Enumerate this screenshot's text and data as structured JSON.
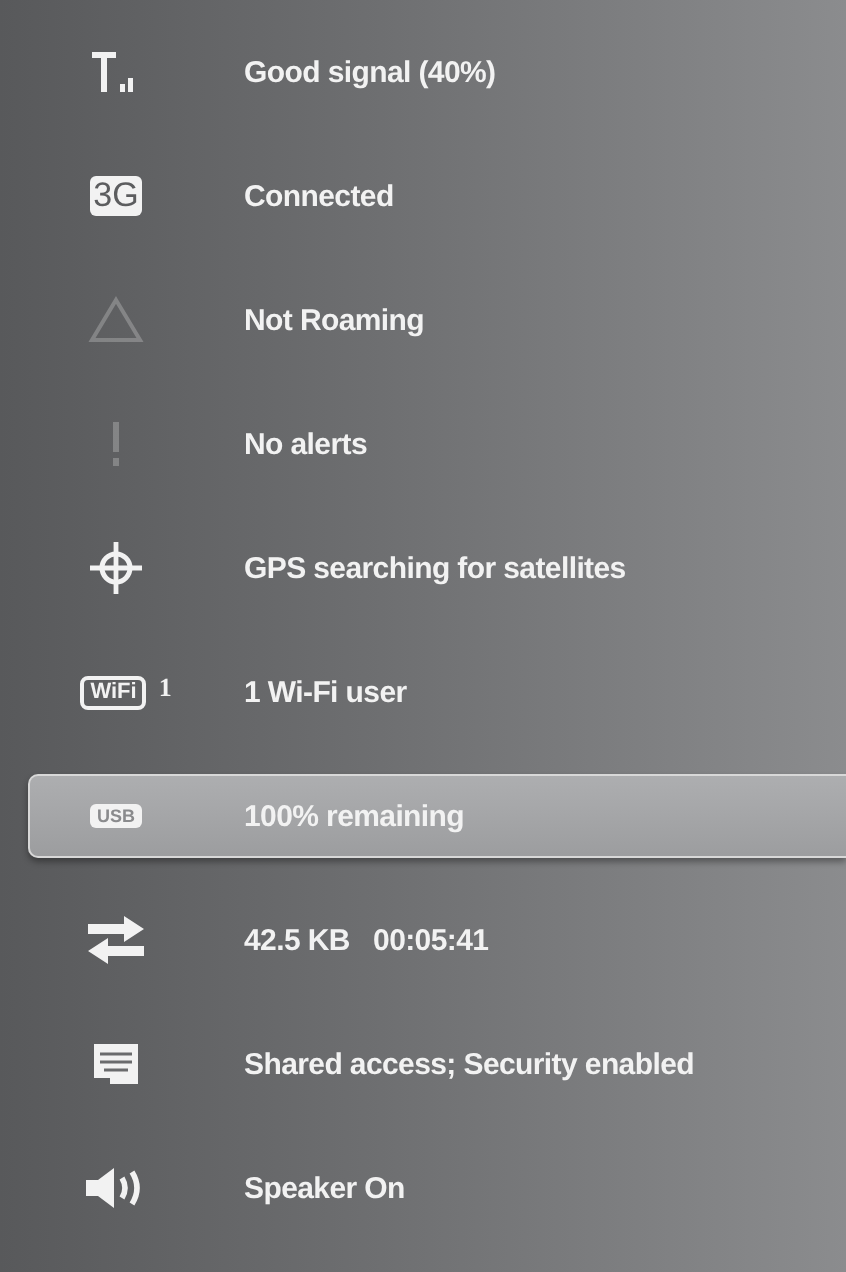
{
  "status_items": [
    {
      "kind": "signal",
      "active": true,
      "selected": false,
      "label": "Good signal (40%)"
    },
    {
      "kind": "network",
      "active": true,
      "selected": false,
      "icon_text": "3G",
      "label": "Connected"
    },
    {
      "kind": "roaming",
      "active": false,
      "selected": false,
      "label": "Not Roaming"
    },
    {
      "kind": "alert",
      "active": false,
      "selected": false,
      "label": "No alerts"
    },
    {
      "kind": "gps",
      "active": true,
      "selected": false,
      "label": "GPS searching for satellites"
    },
    {
      "kind": "wifi",
      "active": true,
      "selected": false,
      "icon_text": "WiFi",
      "badge": "1",
      "label": "1 Wi-Fi user"
    },
    {
      "kind": "battery",
      "active": true,
      "selected": true,
      "icon_text": "USB",
      "label": "100% remaining"
    },
    {
      "kind": "data",
      "active": true,
      "selected": false,
      "label": "42.5 KB   00:05:41"
    },
    {
      "kind": "sdcard",
      "active": true,
      "selected": false,
      "label": "Shared access; Security enabled"
    },
    {
      "kind": "speaker",
      "active": true,
      "selected": false,
      "label": "Speaker On"
    }
  ]
}
